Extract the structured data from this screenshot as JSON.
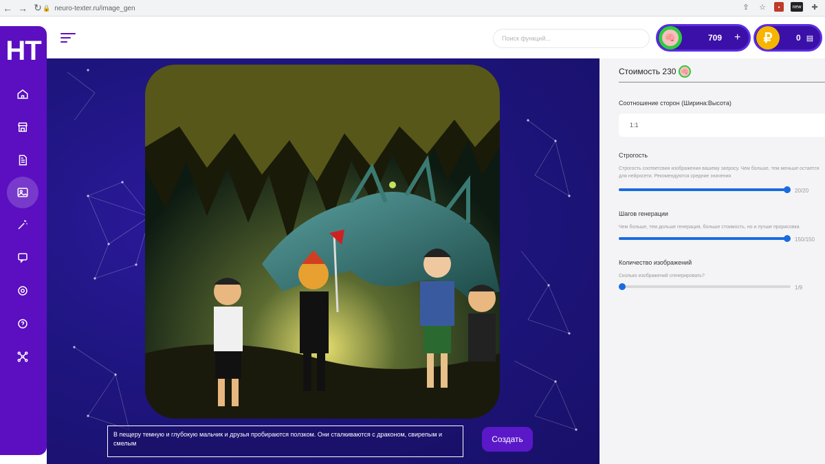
{
  "browser": {
    "url": "neuro-texter.ru/image_gen"
  },
  "sidebar": {
    "logo": "НТ",
    "items": [
      {
        "icon": "home-icon"
      },
      {
        "icon": "store-icon"
      },
      {
        "icon": "document-icon"
      },
      {
        "icon": "image-icon",
        "active": true
      },
      {
        "icon": "magic-wand-icon"
      },
      {
        "icon": "chat-icon"
      },
      {
        "icon": "support-icon"
      },
      {
        "icon": "help-icon"
      },
      {
        "icon": "network-icon"
      }
    ]
  },
  "header": {
    "search_placeholder": "Поиск функций...",
    "brain_balance": "709",
    "coin_balance": "0",
    "plus": "+",
    "coin_symbol": "₽",
    "brain_symbol": "🧠",
    "wallet_symbol": "▤"
  },
  "main": {
    "prompt": "В пещеру темную и глубокую  мальчик и друзья пробираются ползком. Они сталкиваются с драконом, свирепым и смелым",
    "create_label": "Создать"
  },
  "settings": {
    "cost_label": "Стоимость 230",
    "ratio": {
      "label": "Соотношение сторон (Ширина:Высота)",
      "value": "1:1"
    },
    "strictness": {
      "label": "Строгость",
      "hint": "Строгость соответсвия изображения вашему запросу. Чем больше, тем меньше остается для нейросети. Рекомендуются средние значения",
      "value_text": "20/20",
      "fraction": 1.0
    },
    "steps": {
      "label": "Шагов генерации",
      "hint": "Чем больше, тем дольше генерация, больше стоимость, но и лучше прорисовка",
      "value_text": "150/150",
      "fraction": 1.0
    },
    "count": {
      "label": "Количество изображений",
      "hint": "Сколько изображений сгенерировать?",
      "value_text": "1/9",
      "fraction": 0.0
    }
  },
  "colors": {
    "brand": "#5b0fc0",
    "slider": "#1a6bdf"
  }
}
